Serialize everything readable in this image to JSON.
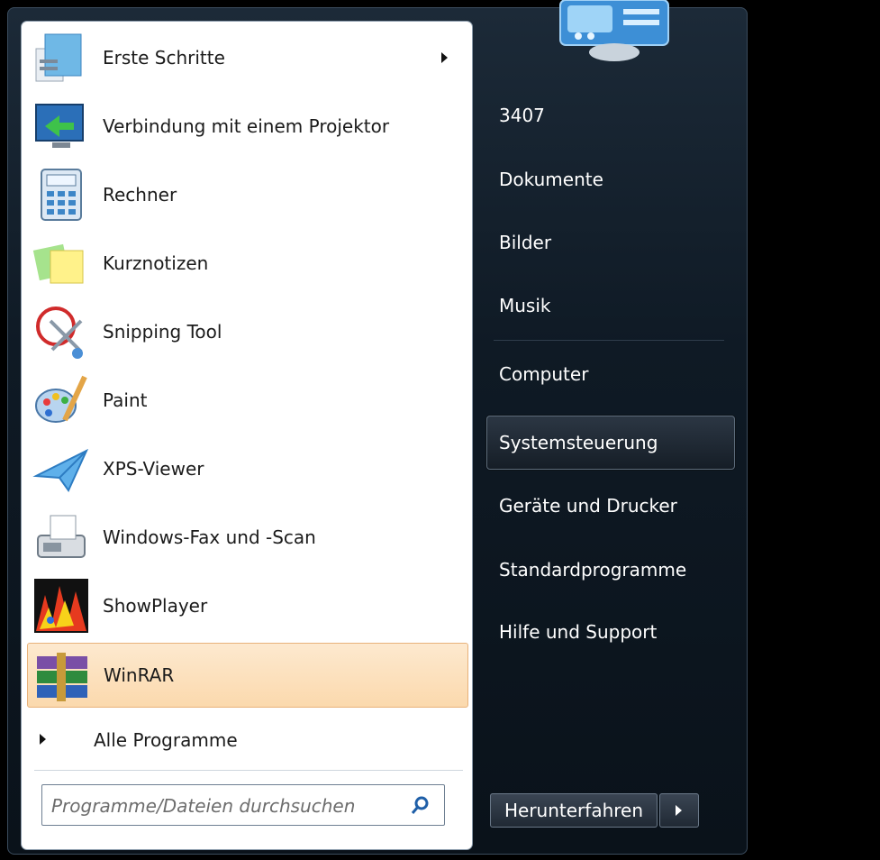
{
  "programs": [
    {
      "label": "Erste Schritte",
      "icon": "getting-started-icon",
      "has_submenu": true
    },
    {
      "label": "Verbindung mit einem Projektor",
      "icon": "projector-icon"
    },
    {
      "label": "Rechner",
      "icon": "calculator-icon"
    },
    {
      "label": "Kurznotizen",
      "icon": "sticky-notes-icon"
    },
    {
      "label": "Snipping Tool",
      "icon": "scissors-icon"
    },
    {
      "label": "Paint",
      "icon": "paint-palette-icon"
    },
    {
      "label": "XPS-Viewer",
      "icon": "paper-plane-icon"
    },
    {
      "label": "Windows-Fax und -Scan",
      "icon": "fax-icon"
    },
    {
      "label": "ShowPlayer",
      "icon": "showplayer-icon"
    },
    {
      "label": "WinRAR",
      "icon": "winrar-icon",
      "highlighted": true
    }
  ],
  "all_programs": "Alle Programme",
  "search": {
    "placeholder": "Programme/Dateien durchsuchen"
  },
  "right_items": [
    {
      "label": "3407"
    },
    {
      "label": "Dokumente"
    },
    {
      "label": "Bilder"
    },
    {
      "label": "Musik"
    },
    {
      "label": "Computer"
    },
    {
      "label": "Systemsteuerung",
      "highlighted": true
    },
    {
      "label": "Geräte und Drucker"
    },
    {
      "label": "Standardprogramme"
    },
    {
      "label": "Hilfe und Support"
    }
  ],
  "shutdown": {
    "label": "Herunterfahren"
  },
  "colors": {
    "highlight": "#fbd9ad",
    "panel_dark": "#0f1a25",
    "text_light": "#ffffff"
  }
}
